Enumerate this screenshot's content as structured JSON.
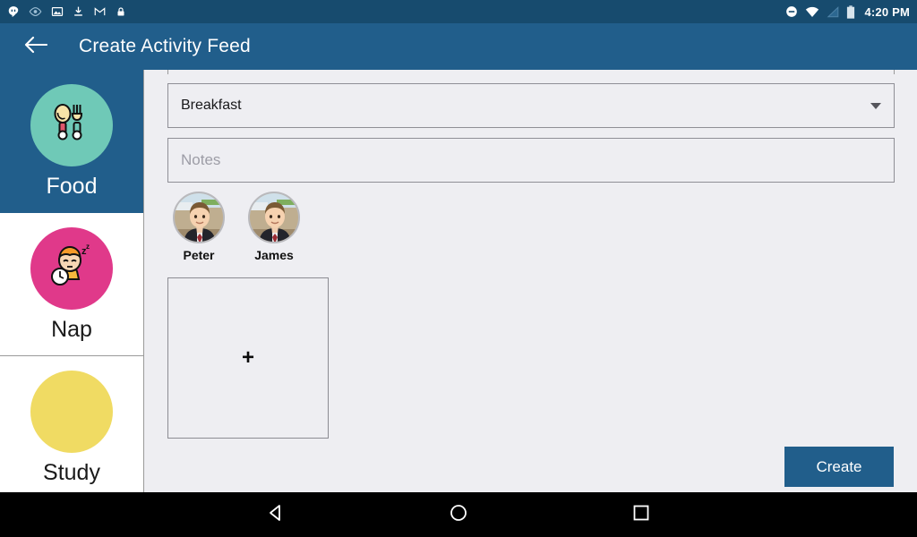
{
  "status_bar": {
    "time": "4:20 PM",
    "left_icons": [
      "hangouts-icon",
      "eye-icon",
      "image-icon",
      "download-icon",
      "gmail-icon",
      "lock-icon"
    ],
    "right_icons": [
      "do-not-disturb-icon",
      "wifi-icon",
      "cellular-signal-icon",
      "battery-icon"
    ],
    "background_color": "#174B6E"
  },
  "app_bar": {
    "title": "Create Activity Feed",
    "back_icon": "arrow-left-icon",
    "background_color": "#215E8B",
    "text_color": "#FFFFFF"
  },
  "sidebar": {
    "items": [
      {
        "label": "Food",
        "icon": "spoon-and-fork-icon",
        "badge_color": "#6FC9B7",
        "selected": true
      },
      {
        "label": "Nap",
        "icon": "sleeping-child-with-clock-icon",
        "badge_color": "#E0398A",
        "selected": false
      },
      {
        "label": "Study",
        "icon": "plain-circle-icon",
        "badge_color": "#F0DB63",
        "selected": false
      }
    ],
    "selected_background_color": "#215E8B",
    "selected_text_color": "#FFFFFF"
  },
  "form": {
    "activity_select": {
      "value": "Breakfast",
      "caret_icon": "chevron-down-icon"
    },
    "notes_field": {
      "value": "",
      "placeholder": "Notes"
    },
    "people": [
      {
        "name": "Peter",
        "avatar": "child-photo-avatar"
      },
      {
        "name": "James",
        "avatar": "child-photo-avatar"
      }
    ],
    "photo_box": {
      "icon": "plus-icon",
      "glyph": "+"
    },
    "create_button": {
      "label": "Create",
      "color": "#215E8B"
    }
  },
  "nav_bar": {
    "buttons": [
      {
        "name": "back-nav-icon"
      },
      {
        "name": "home-nav-icon"
      },
      {
        "name": "recents-nav-icon"
      }
    ],
    "background_color": "#000000"
  },
  "colors": {
    "content_background": "#EEEEF2",
    "field_border": "#8F8F96",
    "divider": "#9A9A9A"
  }
}
